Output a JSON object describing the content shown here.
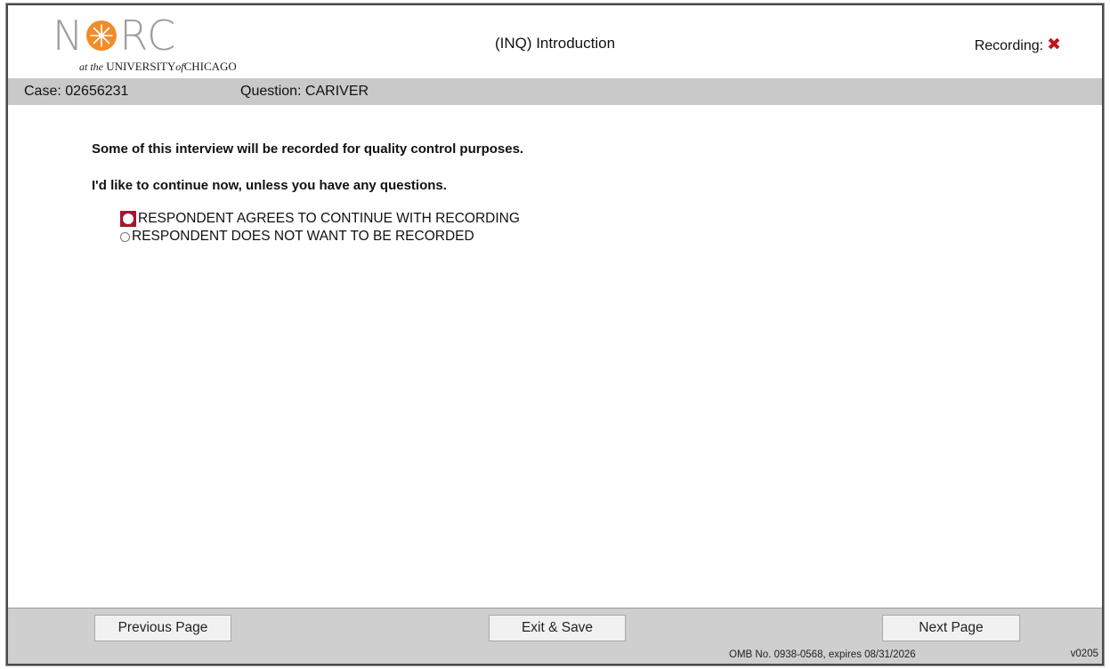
{
  "header": {
    "logo_text_left": "N",
    "logo_text_right": "RC",
    "logo_sub_prefix": "at the",
    "logo_sub_univ": "UNIVERSITY",
    "logo_sub_of": "of",
    "logo_sub_city": "CHICAGO",
    "title": "(INQ) Introduction",
    "recording_label": "Recording:",
    "recording_status_icon": "red-x-icon"
  },
  "infobar": {
    "case": "Case: 02656231",
    "question": "Question: CARIVER"
  },
  "content": {
    "line1": "Some of this interview will be recorded for quality control purposes.",
    "line2": "I'd like to continue now, unless you have any questions.",
    "options": [
      {
        "label": "RESPONDENT AGREES TO CONTINUE WITH RECORDING",
        "selected": true
      },
      {
        "label": "RESPONDENT DOES NOT WANT TO BE RECORDED",
        "selected": false
      }
    ]
  },
  "footer": {
    "prev_label": "Previous Page",
    "exit_label": "Exit & Save",
    "next_label": "Next Page",
    "omb": "OMB No. 0938-0568, expires 08/31/2026",
    "version": "v0205"
  },
  "colors": {
    "accent": "#a8142e",
    "logo_orange": "#f28c28",
    "recording_x": "#c0141c",
    "bar_gray": "#c9c9c9"
  }
}
